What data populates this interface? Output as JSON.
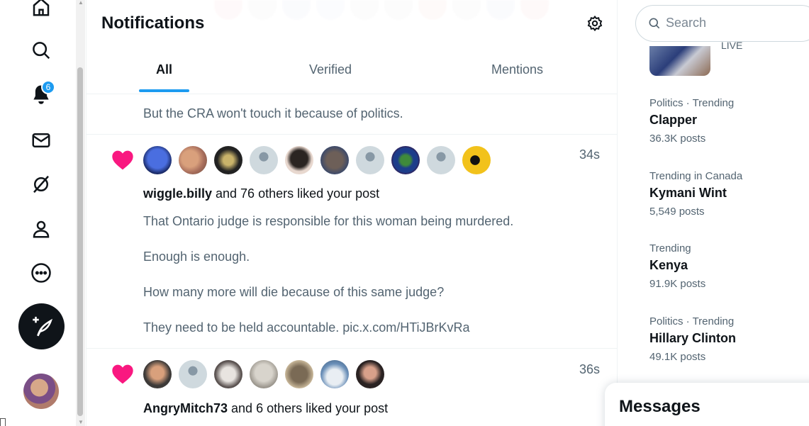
{
  "nav": {
    "notification_count": "6",
    "items": [
      "home",
      "explore",
      "notifications",
      "messages",
      "grok",
      "profile",
      "more"
    ]
  },
  "header": {
    "title": "Notifications",
    "tabs": [
      {
        "label": "All",
        "active": true
      },
      {
        "label": "Verified",
        "active": false
      },
      {
        "label": "Mentions",
        "active": false
      }
    ]
  },
  "feed": {
    "previous_post_line": "But the CRA won't touch it because of politics.",
    "notifications": [
      {
        "time": "34s",
        "user": "wiggle.billy",
        "action": " and 76 others liked your post",
        "post_lines": [
          "That Ontario judge is responsible for this woman being murdered.",
          "Enough is enough.",
          "How many more will die because of this same judge?",
          "They need to be held accountable. pic.x.com/HTiJBrKvRa"
        ]
      },
      {
        "time": "36s",
        "user": "AngryMitch73",
        "action": " and 6 others liked your post"
      }
    ]
  },
  "sidebar": {
    "search_placeholder": "Search",
    "live_label": "LIVE",
    "trends": [
      {
        "meta": "Politics · Trending",
        "name": "Clapper",
        "count": "36.3K posts"
      },
      {
        "meta": "Trending in Canada",
        "name": "Kymani Wint",
        "count": "5,549 posts"
      },
      {
        "meta": "Trending",
        "name": "Kenya",
        "count": "91.9K posts"
      },
      {
        "meta": "Politics · Trending",
        "name": "Hillary Clinton",
        "count": "49.1K posts"
      }
    ]
  },
  "messages_drawer": {
    "title": "Messages"
  },
  "colors": {
    "accent": "#1d9bf0",
    "like": "#f91880",
    "text": "#0f1419",
    "secondary": "#536471"
  }
}
